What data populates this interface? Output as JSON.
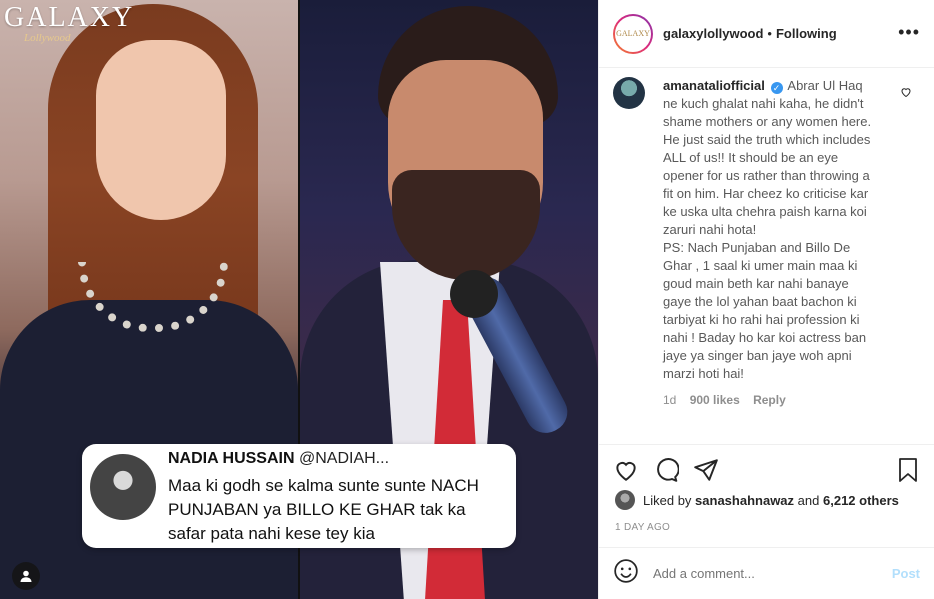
{
  "media": {
    "logo": "GALAXY",
    "logo_sub": "Lollywood",
    "tweet": {
      "name": "NADIA HUSSAIN",
      "handle": "@NADIAH...",
      "text": "Maa ki godh se kalma sunte sunte NACH PUNJABAN ya BILLO KE GHAR tak ka safar pata nahi kese tey kia"
    },
    "icons": {
      "user_tag": "user-tag-icon"
    }
  },
  "header": {
    "username": "galaxylollywood",
    "avatar_text": "GALAXY",
    "separator": "•",
    "follow_status": "Following",
    "more": "•••"
  },
  "comment": {
    "username": "amanataliofficial",
    "verified": true,
    "text": "Abrar Ul Haq ne kuch ghalat nahi kaha, he didn't shame mothers or any women here. He just said the truth which includes ALL of us!! It should be an eye opener for us rather than throwing a fit on him. Har cheez ko criticise kar ke uska ulta chehra paish karna koi zaruri nahi hota!\nPS: Nach Punjaban and Billo De Ghar , 1 saal ki umer main maa ki goud main beth kar nahi banaye gaye the lol yahan baat bachon ki tarbiyat ki ho rahi hai profession ki nahi ! Baday ho kar koi actress ban jaye ya singer ban jaye woh apni marzi hoti hai!",
    "age": "1d",
    "likes": "900 likes",
    "reply": "Reply"
  },
  "likes": {
    "prefix": "Liked by",
    "user": "sanashahnawaz",
    "and": "and",
    "others": "6,212 others"
  },
  "date": "1 DAY AGO",
  "add_comment": {
    "placeholder": "Add a comment...",
    "post_label": "Post"
  },
  "colors": {
    "verified": "#3897f0",
    "post_disabled": "#b2dffc",
    "muted": "#8e8e8e"
  }
}
